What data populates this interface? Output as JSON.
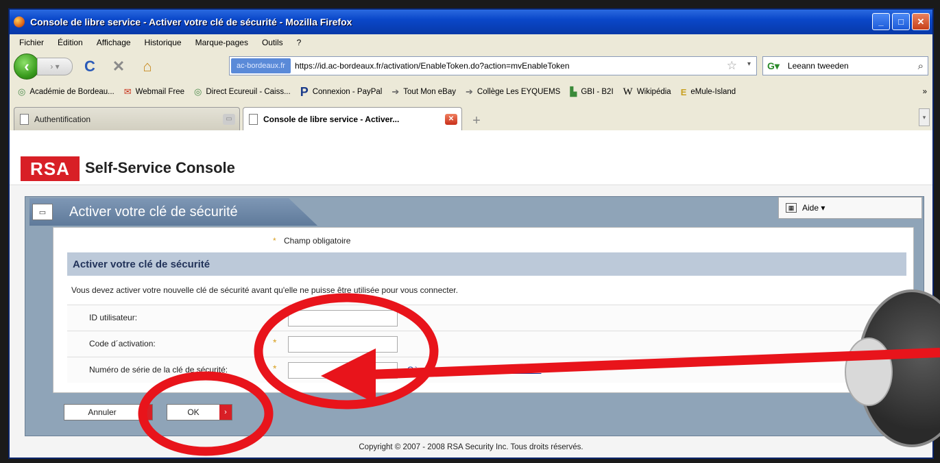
{
  "window": {
    "title": "Console de libre service - Activer votre clé de sécurité - Mozilla Firefox",
    "buttons": {
      "minimize": "_",
      "maximize": "□",
      "close": "✕"
    }
  },
  "menu": [
    "Fichier",
    "Édition",
    "Affichage",
    "Historique",
    "Marque-pages",
    "Outils",
    "?"
  ],
  "nav": {
    "back": "‹",
    "forward": "›  ▾",
    "reload": "C",
    "stop": "✕",
    "home": "⌂",
    "identity": "ac-bordeaux.fr",
    "url": "https://id.ac-bordeaux.fr/activation/EnableToken.do?action=mvEnableToken",
    "star": "☆",
    "url_dropdown": "▾",
    "search_value": "Leeann tweeden",
    "search_engine": "G▾",
    "search_icon": "⌕"
  },
  "bookmarks": [
    {
      "icon": "◎",
      "label": "Académie de Bordeau..."
    },
    {
      "icon": "✉",
      "label": "Webmail Free"
    },
    {
      "icon": "◎",
      "label": "Direct Ecureuil - Caiss..."
    },
    {
      "icon": "P",
      "label": "Connexion - PayPal"
    },
    {
      "icon": "➔",
      "label": "Tout Mon eBay"
    },
    {
      "icon": "➔",
      "label": "Collège Les EYQUEMS"
    },
    {
      "icon": "▙",
      "label": "GBI - B2I"
    },
    {
      "icon": "W",
      "label": "Wikipédia"
    },
    {
      "icon": "E",
      "label": "eMule-Island"
    }
  ],
  "bookmarks_more": "»",
  "tabs": [
    {
      "label": "Authentification",
      "close": "▭"
    },
    {
      "label": "Console de libre service - Activer...",
      "close": "✕"
    }
  ],
  "new_tab": "+",
  "tab_scroll": "▾",
  "page": {
    "logo": "RSA",
    "console_title": "Self-Service Console",
    "banner_icon": "▭",
    "banner_title": "Activer votre clé de sécurité",
    "help": "Aide ▾",
    "help_icon": "▦",
    "required_marker": "*",
    "required_note": "Champ obligatoire",
    "section_title": "Activer votre clé de sécurité",
    "instruction": "Vous devez activer votre nouvelle clé de sécurité avant qu'elle ne puisse être utilisée pour vous connecter.",
    "fields": [
      {
        "label": "ID utilisateur:",
        "required": "",
        "value": ""
      },
      {
        "label": "Code d´activation:",
        "required": "*",
        "value": ""
      },
      {
        "label": "Numéro de série de la clé de sécurité:",
        "required": "*",
        "value": ""
      }
    ],
    "serial_help_link": "Où se trouve mon numéro de série ?",
    "cancel_label": "Annuler",
    "ok_label": "OK",
    "button_arrow": "›",
    "copyright": "Copyright © 2007 - 2008 RSA Security Inc. Tous droits réservés."
  },
  "colors": {
    "rsa_red": "#d81f26",
    "annotation_red": "#e8141b",
    "title_bar": "#0a47c9",
    "section_header": "#bcc9d9",
    "panel": "#8fa4b8"
  }
}
